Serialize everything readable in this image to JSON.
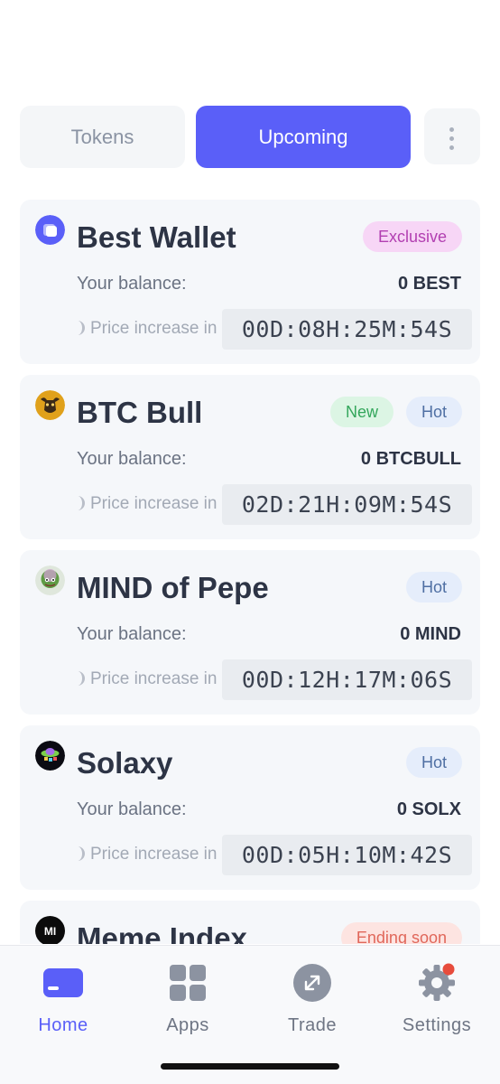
{
  "tabs": {
    "tokens_label": "Tokens",
    "upcoming_label": "Upcoming",
    "active": "Upcoming"
  },
  "cards": [
    {
      "name": "Best Wallet",
      "badges": [
        "Exclusive"
      ],
      "balance_label": "Your balance:",
      "balance": "0 BEST",
      "price_label": "Price increase in",
      "timer": "00D:08H:25M:54S",
      "logo_icon": "best-wallet-logo"
    },
    {
      "name": "BTC Bull",
      "badges": [
        "New",
        "Hot"
      ],
      "balance_label": "Your balance:",
      "balance": "0 BTCBULL",
      "price_label": "Price increase in",
      "timer": "02D:21H:09M:54S",
      "logo_icon": "bull-logo"
    },
    {
      "name": "MIND of Pepe",
      "badges": [
        "Hot"
      ],
      "balance_label": "Your balance:",
      "balance": "0 MIND",
      "price_label": "Price increase in",
      "timer": "00D:12H:17M:06S",
      "logo_icon": "pepe-logo"
    },
    {
      "name": "Solaxy",
      "badges": [
        "Hot"
      ],
      "balance_label": "Your balance:",
      "balance": "0 SOLX",
      "price_label": "Price increase in",
      "timer": "00D:05H:10M:42S",
      "logo_icon": "solaxy-logo"
    },
    {
      "name": "Meme Index",
      "badges": [
        "Ending soon"
      ],
      "logo_text": "MI",
      "logo_icon": "meme-index-logo"
    }
  ],
  "nav": {
    "home_label": "Home",
    "apps_label": "Apps",
    "trade_label": "Trade",
    "settings_label": "Settings",
    "active": "Home"
  },
  "colors": {
    "accent": "#5a5ff8",
    "card_bg": "#f5f7fa",
    "exclusive": "#b23fb1",
    "new": "#33a65b",
    "hot": "#4f6fa3",
    "ending": "#e0675a",
    "notification_dot": "#e74c3c"
  }
}
